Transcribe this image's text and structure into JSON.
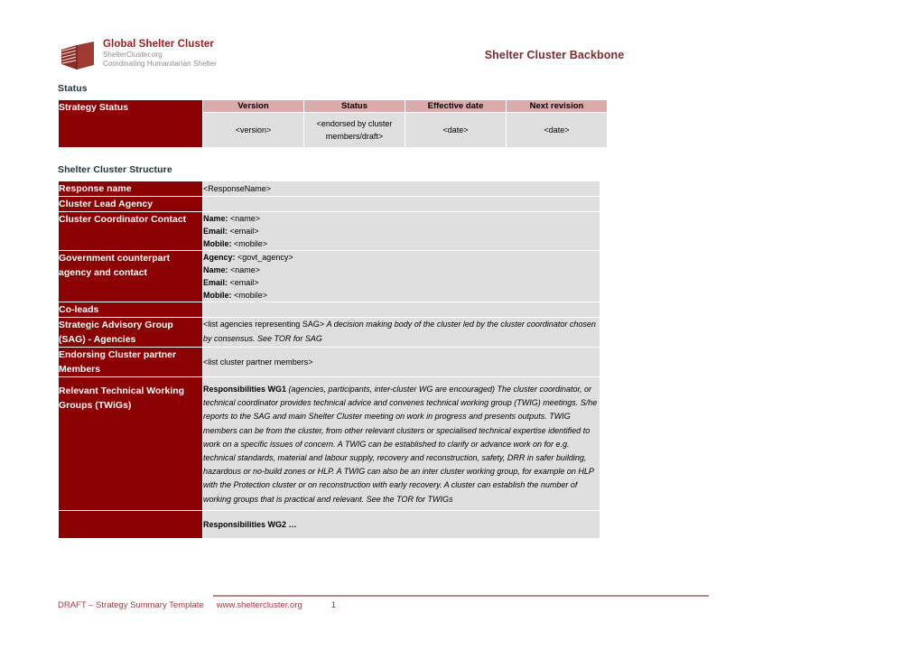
{
  "document": {
    "title": "Shelter Cluster Backbone"
  },
  "logo": {
    "title": "Global Shelter Cluster",
    "subtitle1": "ShelterCluster.org",
    "subtitle2": "Coordinating Humanitarian Shelter",
    "mark_icon": "shelter-book-logo-icon",
    "color": "#9c1c1c"
  },
  "colors": {
    "maroon": "#8B0000",
    "pink": "#DBAAAA",
    "gray": "#DFDFDF",
    "heading": "#1F3040",
    "footer": "#9C3A3A"
  },
  "sections": {
    "status_heading": "Status",
    "structure_heading": "Shelter Cluster Structure"
  },
  "status_table": {
    "row_label": "Strategy Status",
    "headers": [
      "Version",
      "Status",
      "Effective date",
      "Next revision"
    ],
    "values": [
      "<version>",
      "<endorsed by cluster members/draft>",
      "<date>",
      "<date>"
    ]
  },
  "structure_table": {
    "rows": [
      {
        "label": "Response name",
        "value": "<ResponseName>",
        "type": "single"
      },
      {
        "label": "Cluster Lead Agency",
        "value": "",
        "type": "single"
      },
      {
        "label": "Cluster Coordinator Contact",
        "type": "kv",
        "pairs": [
          {
            "key": "Name:",
            "val": "<name>"
          },
          {
            "key": "Email:",
            "val": "<email>"
          },
          {
            "key": "Mobile:",
            "val": "<mobile>"
          }
        ]
      },
      {
        "label": "Government counterpart agency and contact",
        "type": "kv",
        "pairs": [
          {
            "key": "Agency:",
            "val": "<govt_agency>"
          },
          {
            "key": "Name:",
            "val": "<name>"
          },
          {
            "key": "Email:",
            "val": "<email>"
          },
          {
            "key": "Mobile:",
            "val": "<mobile>"
          }
        ]
      },
      {
        "label": "Co-leads",
        "value": "",
        "type": "single"
      },
      {
        "label": "Strategic Advisory Group (SAG) - Agencies",
        "type": "mixed",
        "plain": "<list agencies representing SAG> ",
        "italic": "A decision making body of the cluster led by the cluster coordinator chosen by consensus. See TOR for SAG"
      },
      {
        "label": "Endorsing Cluster partner Members",
        "value": "<list cluster partner members>",
        "type": "single"
      },
      {
        "label": "Relevant Technical Working Groups (TWiGs)",
        "type": "twig",
        "lead": "Responsibilities WG1",
        "body": " (agencies, participants, inter-cluster WG are encouraged) The cluster coordinator, or technical coordinator provides technical advice and convenes technical working group (TWIG) meetings. S/he reports to the SAG and main Shelter Cluster meeting on work in progress and presents outputs. TWIG members can be from the cluster, from other relevant clusters or specialised technical expertise identified to work on a specific issues of concern. A TWIG can be established to clarify or advance work on for e.g. technical standards, material and labour supply, recovery and reconstruction, safety, DRR in safer building, hazardous or no-build zones or HLP. A TWIG can also be an inter cluster working group, for example on HLP with the Protection cluster or on reconstruction with early recovery. A cluster can establish the number of working groups that is practical and relevant. See the TOR for TWIGs",
        "second": "Responsibilities WG2 …"
      }
    ]
  },
  "footer": {
    "draft_label": "DRAFT – Strategy Summary Template",
    "website": "www.sheltercluster.org",
    "page_number": "1"
  }
}
